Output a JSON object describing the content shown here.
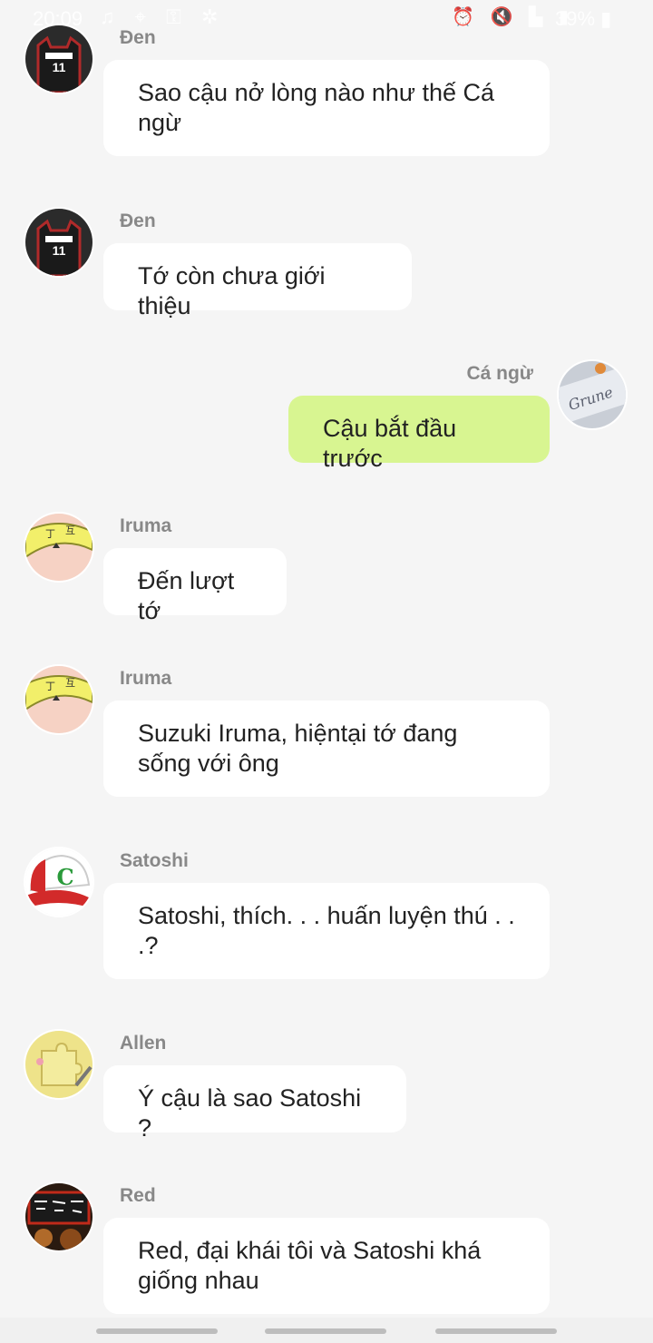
{
  "status_bar": {
    "time": "20:09",
    "left_icons": "♫ ⌖ ⚿ ✲",
    "right_icons": "⏰ 🔇 ▙ ▮",
    "battery": "39% ▮"
  },
  "colors": {
    "background": "#f5f5f5",
    "incoming_bubble": "#ffffff",
    "outgoing_bubble": "#d8f591",
    "name_text": "#888888"
  },
  "messages": [
    {
      "sender": "Đen",
      "text": "Sao cậu nở lòng nào như thế Cá ngừ",
      "direction": "incoming",
      "avatar": "seirin-jersey-avatar"
    },
    {
      "sender": "Đen",
      "text": "Tớ còn chưa giới thiệu",
      "direction": "incoming",
      "avatar": "seirin-jersey-avatar"
    },
    {
      "sender": "Cá ngừ",
      "text": "Cậu bắt đầu trước",
      "direction": "outgoing",
      "avatar": "paper-note-avatar"
    },
    {
      "sender": "Iruma",
      "text": "Đến lượt tớ",
      "direction": "incoming",
      "avatar": "headband-avatar"
    },
    {
      "sender": "Iruma",
      "text": "Suzuki Iruma, hiệntại tớ đang sống với ông",
      "direction": "incoming",
      "avatar": "headband-avatar"
    },
    {
      "sender": "Satoshi",
      "text": "Satoshi, thích. . . huấn luyện thú . . .?",
      "direction": "incoming",
      "avatar": "cap-avatar"
    },
    {
      "sender": "Allen",
      "text": "Ý cậu là sao Satoshi ?",
      "direction": "incoming",
      "avatar": "puzzle-avatar"
    },
    {
      "sender": "Red",
      "text": "Red, đại khái tôi và Satoshi khá giống nhau",
      "direction": "incoming",
      "avatar": "sign-avatar"
    }
  ]
}
